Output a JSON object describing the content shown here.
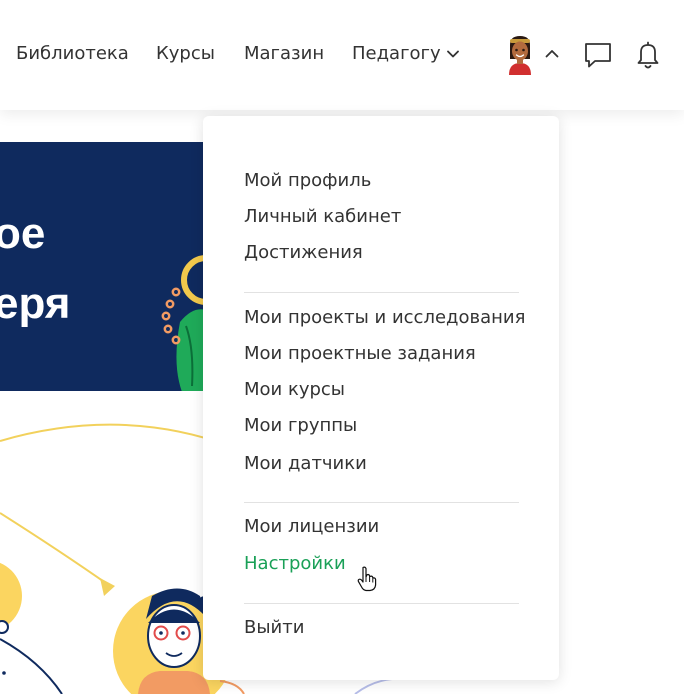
{
  "nav": {
    "library": "Библиотека",
    "courses": "Курсы",
    "shop": "Магазин",
    "teacher": "Педагогу"
  },
  "banner": {
    "line1": "ое",
    "line2": "еря"
  },
  "user_menu": {
    "groups": [
      [
        "Мой профиль",
        "Личный кабинет",
        "Достижения"
      ],
      [
        "Мои проекты и исследования",
        "Мои проектные задания",
        "Мои курсы",
        "Мои группы",
        "Мои датчики"
      ],
      [
        "Мои лицензии",
        "Настройки"
      ],
      [
        "Выйти"
      ]
    ],
    "active_item": "Настройки"
  },
  "icons": {
    "teacher_chevron": "chevron-down-icon",
    "avatar_chevron": "chevron-up-icon",
    "chat": "chat-icon",
    "notifications": "bell-icon",
    "cursor": "hand-pointer-icon"
  },
  "colors": {
    "accent": "#1aa057",
    "text": "#333333",
    "banner_bg": "#0f2a5e",
    "divider": "#e2e2e2"
  }
}
